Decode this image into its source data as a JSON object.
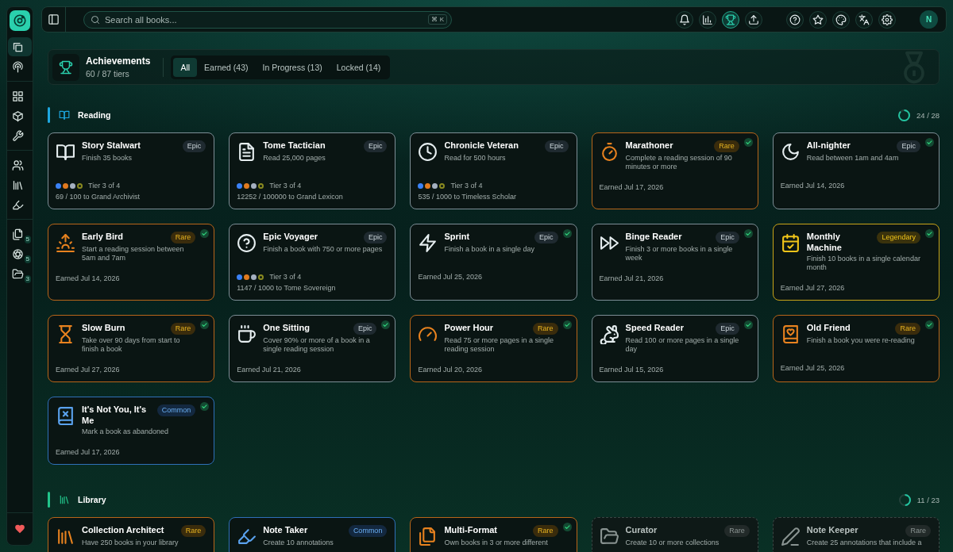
{
  "sidebar": {
    "groups": [
      {
        "items": [
          {
            "selected": true
          },
          {
            "selected": false
          }
        ]
      },
      {
        "items": [
          {
            "selected": false
          },
          {
            "selected": false
          },
          {
            "selected": false
          }
        ]
      },
      {
        "items": [
          {
            "selected": false
          },
          {
            "selected": false
          },
          {
            "selected": false
          }
        ]
      },
      {
        "items": [
          {
            "selected": false,
            "badge": "5"
          },
          {
            "selected": false,
            "badge": "5"
          },
          {
            "selected": false,
            "badge": "3"
          }
        ]
      }
    ]
  },
  "toolbar": {
    "search": {
      "placeholder": "Search all books...",
      "shortcut": "⌘ K"
    },
    "buttons": [
      {
        "selected": false
      },
      {
        "selected": false
      },
      {
        "selected": true
      },
      {
        "selected": false
      },
      {
        "selected": false
      },
      {
        "selected": false
      },
      {
        "selected": false
      },
      {
        "selected": false
      },
      {
        "selected": false
      }
    ],
    "avatar": "N"
  },
  "achievements": {
    "title": "Achievements",
    "subtitle": "60 / 87 tiers",
    "tabs": [
      {
        "label": "All",
        "selected": true
      },
      {
        "label": "Earned (43)",
        "selected": false
      },
      {
        "label": "In Progress (13)",
        "selected": false
      },
      {
        "label": "Locked (14)",
        "selected": false
      }
    ]
  },
  "sections": [
    {
      "title": "Reading",
      "color": "#1ea7e0",
      "progress": "24 / 28",
      "cards": [
        {
          "title": "Story Stalwart",
          "rarity": "Epic",
          "kind": "epic",
          "description": "Finish 35 books",
          "earned": false,
          "locked": false,
          "tiers": [
            {
              "color": "#3b82f6",
              "reached": true
            },
            {
              "color": "#e07a1f",
              "reached": true
            },
            {
              "color": "#a5b0c0",
              "reached": true
            },
            {
              "color": "#8a8a20",
              "reached": false
            }
          ],
          "tier_label": "Tier 3 of 4",
          "progress": "69 / 100 to Grand Archivist"
        },
        {
          "title": "Tome Tactician",
          "rarity": "Epic",
          "kind": "epic",
          "description": "Read 25,000 pages",
          "earned": false,
          "locked": false,
          "tiers": [
            {
              "color": "#3b82f6",
              "reached": true
            },
            {
              "color": "#e07a1f",
              "reached": true
            },
            {
              "color": "#a5b0c0",
              "reached": true
            },
            {
              "color": "#8a8a20",
              "reached": false
            }
          ],
          "tier_label": "Tier 3 of 4",
          "progress": "12252 / 100000 to Grand Lexicon"
        },
        {
          "title": "Chronicle Veteran",
          "rarity": "Epic",
          "kind": "epic",
          "description": "Read for 500 hours",
          "earned": false,
          "locked": false,
          "tiers": [
            {
              "color": "#3b82f6",
              "reached": true
            },
            {
              "color": "#e07a1f",
              "reached": true
            },
            {
              "color": "#a5b0c0",
              "reached": true
            },
            {
              "color": "#8a8a20",
              "reached": false
            }
          ],
          "tier_label": "Tier 3 of 4",
          "progress": "535 / 1000 to Timeless Scholar"
        },
        {
          "title": "Marathoner",
          "rarity": "Rare",
          "kind": "rare",
          "description": "Complete a reading session of 90 minutes or more",
          "earned": true,
          "locked": false,
          "date": "Earned Jul 17, 2026"
        },
        {
          "title": "All-nighter",
          "rarity": "Epic",
          "kind": "epic",
          "description": "Read between 1am and 4am",
          "earned": true,
          "locked": false,
          "date": "Earned Jul 14, 2026"
        },
        {
          "title": "Early Bird",
          "rarity": "Rare",
          "kind": "rare",
          "description": "Start a reading session between 5am and 7am",
          "earned": true,
          "locked": false,
          "date": "Earned Jul 14, 2026"
        },
        {
          "title": "Epic Voyager",
          "rarity": "Epic",
          "kind": "epic",
          "description": "Finish a book with 750 or more pages",
          "earned": false,
          "locked": false,
          "tiers": [
            {
              "color": "#3b82f6",
              "reached": true
            },
            {
              "color": "#e07a1f",
              "reached": true
            },
            {
              "color": "#a5b0c0",
              "reached": true
            },
            {
              "color": "#8a8a20",
              "reached": false
            }
          ],
          "tier_label": "Tier 3 of 4",
          "progress": "1147 / 1000 to Tome Sovereign"
        },
        {
          "title": "Sprint",
          "rarity": "Epic",
          "kind": "epic",
          "description": "Finish a book in a single day",
          "earned": true,
          "locked": false,
          "date": "Earned Jul 25, 2026"
        },
        {
          "title": "Binge Reader",
          "rarity": "Epic",
          "kind": "epic",
          "description": "Finish 3 or more books in a single week",
          "earned": true,
          "locked": false,
          "date": "Earned Jul 21, 2026"
        },
        {
          "title": "Monthly Machine",
          "rarity": "Legendary",
          "kind": "legendary",
          "description": "Finish 10 books in a single calendar month",
          "earned": true,
          "locked": false,
          "date": "Earned Jul 27, 2026"
        },
        {
          "title": "Slow Burn",
          "rarity": "Rare",
          "kind": "rare",
          "description": "Take over 90 days from start to finish a book",
          "earned": true,
          "locked": false,
          "date": "Earned Jul 27, 2026"
        },
        {
          "title": "One Sitting",
          "rarity": "Epic",
          "kind": "epic",
          "description": "Cover 90% or more of a book in a single reading session",
          "earned": true,
          "locked": false,
          "date": "Earned Jul 21, 2026"
        },
        {
          "title": "Power Hour",
          "rarity": "Rare",
          "kind": "rare",
          "description": "Read 75 or more pages in a single reading session",
          "earned": true,
          "locked": false,
          "date": "Earned Jul 20, 2026"
        },
        {
          "title": "Speed Reader",
          "rarity": "Epic",
          "kind": "epic",
          "description": "Read 100 or more pages in a single day",
          "earned": true,
          "locked": false,
          "date": "Earned Jul 15, 2026"
        },
        {
          "title": "Old Friend",
          "rarity": "Rare",
          "kind": "rare",
          "description": "Finish a book you were re-reading",
          "earned": true,
          "locked": false,
          "date": "Earned Jul 25, 2026"
        },
        {
          "title": "It's Not You, It's Me",
          "rarity": "Common",
          "kind": "common",
          "description": "Mark a book as abandoned",
          "earned": true,
          "locked": false,
          "date": "Earned Jul 17, 2026"
        }
      ]
    },
    {
      "title": "Library",
      "color": "#22c48a",
      "progress": "11 / 23",
      "cards": [
        {
          "title": "Collection Architect",
          "rarity": "Rare",
          "kind": "rare",
          "description": "Have 250 books in your library",
          "earned": false,
          "locked": false
        },
        {
          "title": "Note Taker",
          "rarity": "Common",
          "kind": "common",
          "description": "Create 10 annotations",
          "earned": false,
          "locked": false
        },
        {
          "title": "Multi-Format",
          "rarity": "Rare",
          "kind": "rare",
          "description": "Own books in 3 or more different",
          "earned": true,
          "locked": false
        },
        {
          "title": "Curator",
          "rarity": "Rare",
          "kind": "rare",
          "description": "Create 10 or more collections",
          "earned": false,
          "locked": true
        },
        {
          "title": "Note Keeper",
          "rarity": "Rare",
          "kind": "rare",
          "description": "Create 25 annotations that include a",
          "earned": false,
          "locked": true
        }
      ]
    }
  ]
}
